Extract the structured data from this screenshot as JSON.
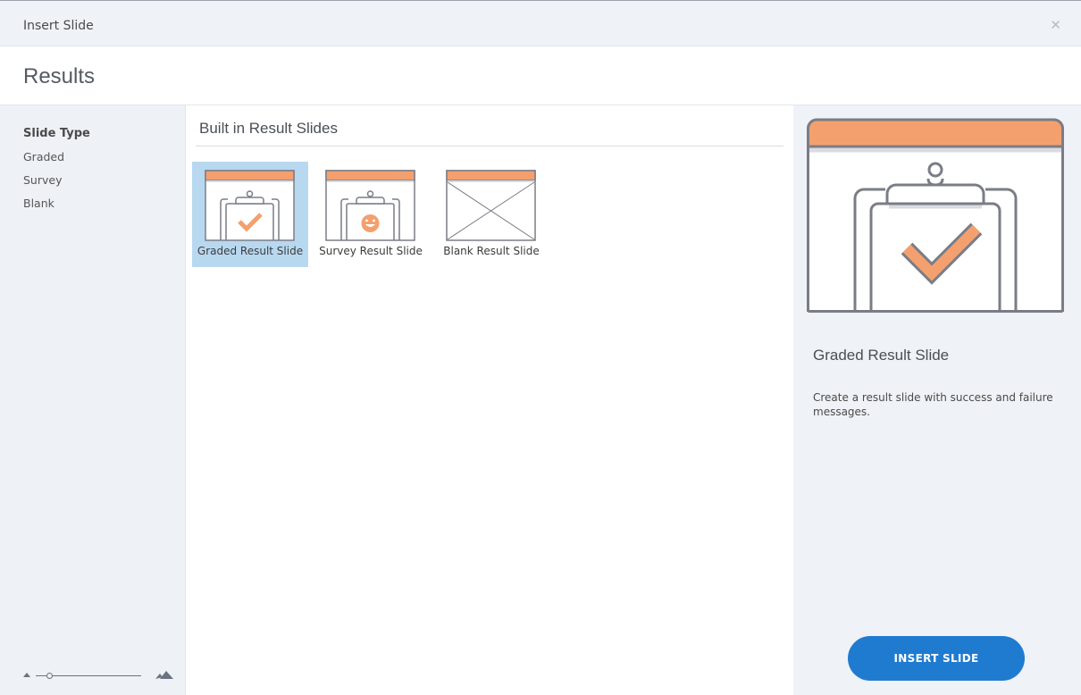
{
  "window": {
    "title": "Insert Slide",
    "close_icon": "close-icon"
  },
  "page": {
    "heading": "Results"
  },
  "sidebar": {
    "title": "Slide Type",
    "items": [
      {
        "label": "Graded"
      },
      {
        "label": "Survey"
      },
      {
        "label": "Blank"
      }
    ],
    "zoom": {
      "level": 0.1
    }
  },
  "main": {
    "section_title": "Built in Result Slides",
    "thumbnails": [
      {
        "label": "Graded Result Slide",
        "icon": "graded-clipboard-icon",
        "selected": true
      },
      {
        "label": "Survey Result Slide",
        "icon": "survey-clipboard-icon",
        "selected": false
      },
      {
        "label": "Blank Result Slide",
        "icon": "blank-slide-icon",
        "selected": false
      }
    ]
  },
  "preview": {
    "title": "Graded Result Slide",
    "description": "Create a result slide with success and failure messages.",
    "icon": "graded-clipboard-icon"
  },
  "actions": {
    "insert_label": "INSERT SLIDE"
  },
  "colors": {
    "accent": "#1f7bd0",
    "orange": "#f4a06e",
    "selection": "#b8d8f0",
    "stroke": "#7a7d86"
  }
}
